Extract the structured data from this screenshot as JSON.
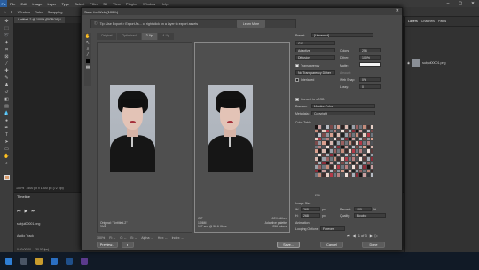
{
  "menubar": {
    "logo": "Ps",
    "items": [
      "File",
      "Edit",
      "Image",
      "Layer",
      "Type",
      "Select",
      "Filter",
      "3D",
      "View",
      "Plugins",
      "Window",
      "Help"
    ]
  },
  "optionbar": {
    "items": [
      "Window",
      "Ruler",
      "Snapping"
    ]
  },
  "doctab": {
    "label": "Untitled-2 @ 100% (RGB/16) *"
  },
  "status": {
    "zoom": "100%",
    "doc": "1500 px x 1500 px (72 ppi)"
  },
  "timeline": {
    "title": "Timeline",
    "layer": "subjul00001.png",
    "audio": "Audio Track",
    "time": "0:00:00:00",
    "fps": "(30.00 fps)"
  },
  "rightpanel": {
    "tabs": [
      "Layers",
      "Channels",
      "Paths"
    ],
    "layer_name": "subjul00001.png"
  },
  "dialog": {
    "title": "Save for Web (100%)",
    "hint": "Tip: Use Export > Export As... or right click on a layer to export assets",
    "learn_more": "Learn More",
    "view_tabs": [
      "Original",
      "Optimized",
      "2-Up",
      "4-Up"
    ],
    "active_tab": "2-Up",
    "left_pane": {
      "label": "Original: \"Untitled-2\"",
      "size": "9MB"
    },
    "right_pane": {
      "label": "GIF",
      "size": "1.06M",
      "time": "197 sec @ 56.6 Kbps",
      "dither": "100% dither",
      "palette": "Adaptive palette",
      "colors": "256 colors"
    },
    "bottom": {
      "zoom": "100%",
      "r": "R: --",
      "g": "G: --",
      "b": "B: --",
      "alpha": "Alpha: --",
      "hex": "Hex: --",
      "index": "Index: --"
    },
    "buttons": {
      "preview": "Preview...",
      "save": "Save...",
      "cancel": "Cancel",
      "done": "Done"
    },
    "settings": {
      "preset_label": "Preset:",
      "preset_value": "[Unnamed]",
      "format": "GIF",
      "reduction": "Adaptive",
      "dither_algo": "Diffusion",
      "colors_label": "Colors:",
      "colors_value": "256",
      "dither_label": "Dither:",
      "dither_value": "100%",
      "transparency": "Transparency",
      "matte_label": "Matte:",
      "no_transp_dither": "No Transparency Dither",
      "amount_label": "Amount:",
      "interlaced": "Interlaced",
      "web_snap_label": "Web Snap:",
      "web_snap_value": "0%",
      "lossy_label": "Lossy:",
      "lossy_value": "0",
      "convert_srgb": "Convert to sRGB",
      "preview_label": "Preview:",
      "preview_value": "Monitor Color",
      "metadata_label": "Metadata:",
      "metadata_value": "Copyright",
      "color_table": "Color Table",
      "color_count": "256",
      "image_size": "Image Size",
      "w_label": "W:",
      "w_value": "268",
      "h_label": "H:",
      "h_value": "268",
      "px": "px",
      "percent_label": "Percent:",
      "percent_value": "100",
      "pct": "%",
      "quality_label": "Quality:",
      "quality_value": "Bicubic",
      "animation": "Animation",
      "looping_label": "Looping Options:",
      "looping_value": "Forever",
      "frame": "1 of 3"
    }
  }
}
